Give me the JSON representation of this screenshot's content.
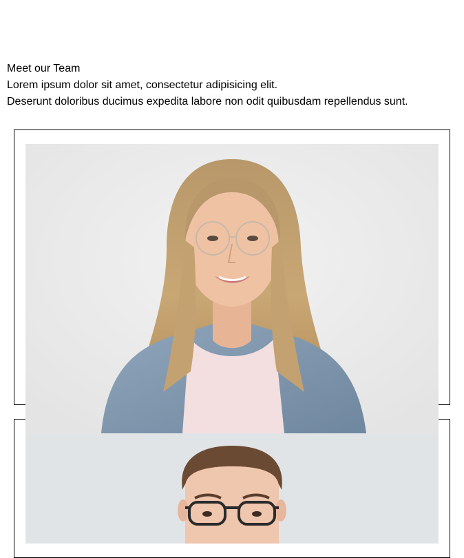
{
  "team": {
    "heading": "Meet our Team",
    "line1": "Lorem ipsum dolor sit amet, consectetur adipisicing elit.",
    "line2": "Deserunt doloribus ducimus expedita labore non odit quibusdam repellendus sunt."
  },
  "members": [
    {
      "photo": "woman-portrait"
    },
    {
      "photo": "man-portrait"
    }
  ],
  "colors": {
    "card_border": "#000000",
    "photo_bg_1": "#ececec",
    "photo_bg_2": "#e1e4e6"
  }
}
